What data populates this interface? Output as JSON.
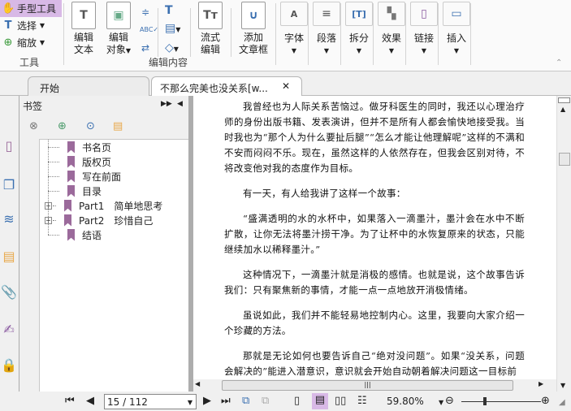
{
  "ribbon": {
    "tools": [
      {
        "label": "手型工具",
        "icon": "hand-icon",
        "selected": true
      },
      {
        "label": "选择",
        "icon": "select-cursor-icon"
      },
      {
        "label": "缩放",
        "icon": "zoom-icon"
      }
    ],
    "tools_group": "工具",
    "edit_text": [
      "编辑",
      "文本"
    ],
    "edit_object": [
      "编辑",
      "对象"
    ],
    "flow_edit": [
      "流式",
      "编辑"
    ],
    "add_textbox": [
      "添加",
      "文章框"
    ],
    "edit_group": "编辑内容",
    "format_buttons": [
      {
        "label": "字体",
        "icon": "font-icon"
      },
      {
        "label": "段落",
        "icon": "paragraph-icon"
      },
      {
        "label": "拆分",
        "icon": "split-icon"
      },
      {
        "label": "效果",
        "icon": "effect-icon"
      },
      {
        "label": "链接",
        "icon": "link-icon"
      },
      {
        "label": "插入",
        "icon": "insert-icon"
      }
    ]
  },
  "tabs": [
    {
      "label": "开始"
    },
    {
      "label": "不那么完美也没关系[w..."
    }
  ],
  "bookmarks": {
    "title": "书签",
    "items": [
      {
        "label": "书名页"
      },
      {
        "label": "版权页"
      },
      {
        "label": "写在前面"
      },
      {
        "label": "目录"
      },
      {
        "label": "Part1　简单地思考",
        "expandable": true
      },
      {
        "label": "Part2　珍惜自己",
        "expandable": true
      },
      {
        "label": "结语"
      }
    ]
  },
  "document": {
    "paragraphs": [
      "我曾经也为人际关系苦恼过。做牙科医生的同时，我还以心理治疗师的身份出版书籍、发表演讲，但并不是所有人都会愉快地接受我。当时我也为“那个人为什么要扯后腿”“怎么才能让他理解呢”这样的不满和不安而闷闷不乐。现在，虽然这样的人依然存在，但我会区别对待，不将改变他对我的态度作为目标。",
      "有一天，有人给我讲了这样一个故事：",
      "“盛满透明的水的水杯中，如果落入一滴墨汁，墨汁会在水中不断扩散，让你无法将墨汁捞干净。为了让杯中的水恢复原来的状态，只能继续加水以稀释墨汁。”",
      "这种情况下，一滴墨汁就是消极的感情。也就是说，这个故事告诉我们：只有聚焦新的事情，才能一点一点地放开消极情绪。",
      "虽说如此，我们并不能轻易地控制内心。这里，我要向大家介绍一个珍藏的方法。",
      "那就是无论如何也要告诉自己“绝对没问题”。如果“没关系，问题会解决的”能进入潜意识，意识就会开始自动朝着解决问题这一目标前"
    ]
  },
  "status": {
    "page": "15 / 112",
    "zoom": "59.80%",
    "zoom_slider_fraction": 0.3
  },
  "colors": {
    "accent": "#d8b9e6",
    "bookmark": "#9b6a9b"
  }
}
